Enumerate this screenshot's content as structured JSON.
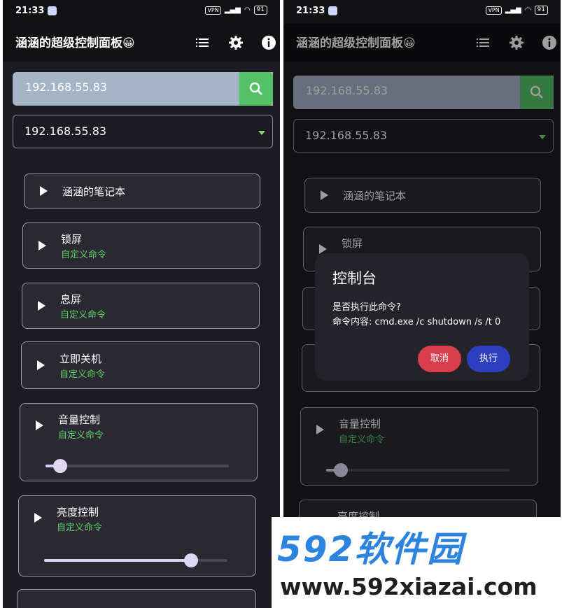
{
  "status": {
    "time": "21:33",
    "vpn": "VPN",
    "battery": "91"
  },
  "app": {
    "title": "涵涵的超级控制面板😀"
  },
  "ip_input": {
    "value": "192.168.55.83"
  },
  "dropdown": {
    "selected": "192.168.55.83"
  },
  "cards": [
    {
      "title": "涵涵的笔记本",
      "subtitle": ""
    },
    {
      "title": "锁屏",
      "subtitle": "自定义命令"
    },
    {
      "title": "息屏",
      "subtitle": "自定义命令"
    },
    {
      "title": "立即关机",
      "subtitle": "自定义命令"
    },
    {
      "title": "音量控制",
      "subtitle": "自定义命令",
      "slider_level": 0.08
    },
    {
      "title": "亮度控制",
      "subtitle": "自定义命令",
      "slider_level": 0.8
    }
  ],
  "dialog": {
    "title": "控制台",
    "line1": "是否执行此命令?",
    "line2": "命令内容: cmd.exe /c shutdown /s /t 0",
    "cancel_label": "取消",
    "execute_label": "执行"
  },
  "watermark": {
    "brand": "592软件园",
    "url": "www.592xiazai.com"
  },
  "colors": {
    "accent_green": "#54c167",
    "cancel_red": "#d93e4c",
    "execute_blue": "#2d3fbe"
  },
  "icons": [
    "list-icon",
    "gear-icon",
    "info-icon",
    "search-icon",
    "chevron-down-icon",
    "play-icon"
  ]
}
